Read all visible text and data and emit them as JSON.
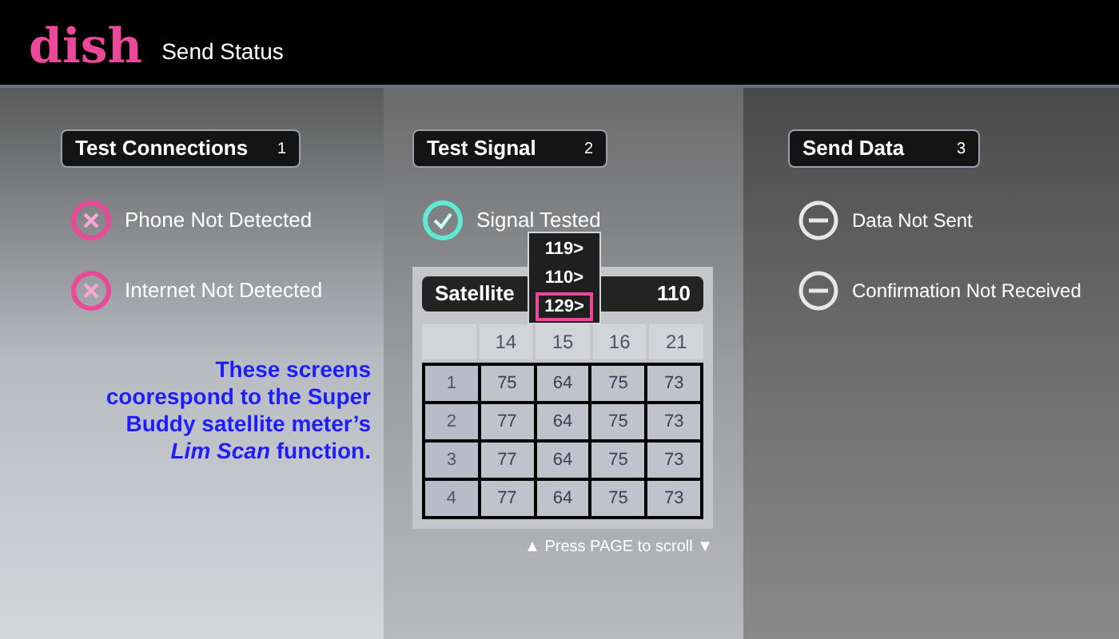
{
  "header": {
    "logo": "dish",
    "title": "Send Status"
  },
  "note": "These screens coorespond to the Super Buddy satellite meter’s *Lim Scan* function.",
  "sections": [
    {
      "title": "Test Connections",
      "number": "1",
      "items": [
        {
          "kind": "error",
          "label": "Phone Not Detected"
        },
        {
          "kind": "error",
          "label": "Internet Not Detected"
        }
      ]
    },
    {
      "title": "Test Signal",
      "number": "2",
      "items": [
        {
          "kind": "ok",
          "label": "Signal Tested"
        }
      ]
    },
    {
      "title": "Send Data",
      "number": "3",
      "items": [
        {
          "kind": "pending",
          "label": "Data Not Sent"
        },
        {
          "kind": "pending",
          "label": "Confirmation Not Received"
        }
      ]
    }
  ],
  "satellite": {
    "label": "Satellite",
    "value": "110",
    "options": [
      {
        "label": "119>",
        "selected": false
      },
      {
        "label": "110>",
        "selected": false
      },
      {
        "label": "129>",
        "selected": true
      }
    ],
    "columns": [
      "14",
      "15",
      "16",
      "21"
    ],
    "rows": [
      {
        "label": "1",
        "cells": [
          "75",
          "64",
          "75",
          "73"
        ]
      },
      {
        "label": "2",
        "cells": [
          "77",
          "64",
          "75",
          "73"
        ]
      },
      {
        "label": "3",
        "cells": [
          "77",
          "64",
          "75",
          "73"
        ]
      },
      {
        "label": "4",
        "cells": [
          "77",
          "64",
          "75",
          "73"
        ]
      }
    ],
    "hint": "▲ Press PAGE to scroll ▼"
  }
}
